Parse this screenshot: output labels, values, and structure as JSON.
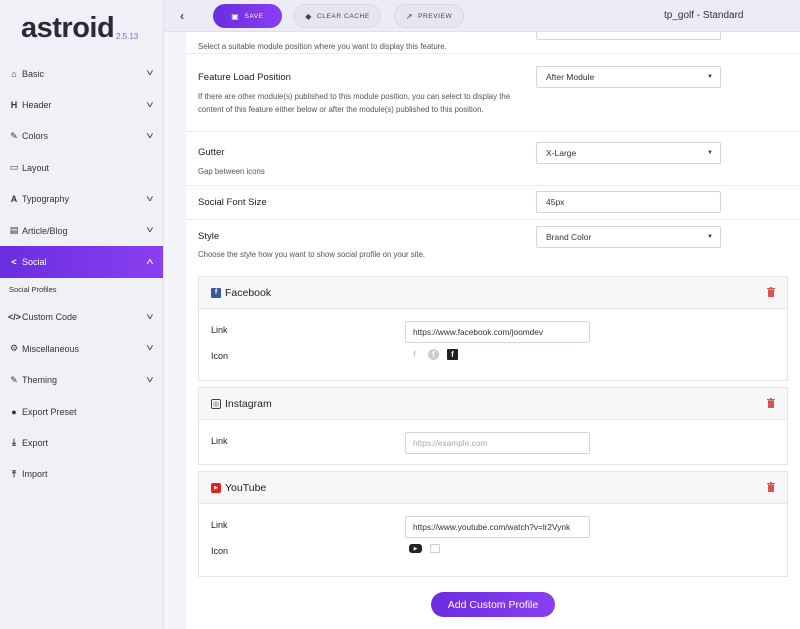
{
  "logo": {
    "text": "astroid",
    "version": "2.5.13"
  },
  "sidebar": {
    "items": [
      {
        "label": "Basic",
        "icon": "home-icon",
        "glyph": "⌂"
      },
      {
        "label": "Header",
        "icon": "header-icon",
        "glyph": "H"
      },
      {
        "label": "Colors",
        "icon": "brush-icon",
        "glyph": "✎"
      },
      {
        "label": "Layout",
        "icon": "layout-icon",
        "glyph": "▭"
      },
      {
        "label": "Typography",
        "icon": "typography-icon",
        "glyph": "A"
      },
      {
        "label": "Article/Blog",
        "icon": "article-icon",
        "glyph": "▤"
      },
      {
        "label": "Social",
        "icon": "share-icon",
        "glyph": "<"
      },
      {
        "label": "Custom Code",
        "icon": "code-icon",
        "glyph": "</>"
      },
      {
        "label": "Miscellaneous",
        "icon": "cogs-icon",
        "glyph": "⚙"
      },
      {
        "label": "Theming",
        "icon": "brush-icon",
        "glyph": "✎"
      },
      {
        "label": "Export Preset",
        "icon": "palette-icon",
        "glyph": "●"
      },
      {
        "label": "Export",
        "icon": "download-icon",
        "glyph": "⤓"
      },
      {
        "label": "Import",
        "icon": "upload-icon",
        "glyph": "⤒"
      }
    ],
    "sub_item": "Social Profiles"
  },
  "toolbar": {
    "save_label": "SAVE",
    "clear_label": "CLEAR CACHE",
    "preview_label": "PREVIEW",
    "template_name": "tp_golf - Standard"
  },
  "settings": {
    "position_desc": "Select a suitable module position where you want to display this feature.",
    "load_position": {
      "title": "Feature Load Position",
      "desc": "If there are other module(s) published to this module position, you can select to display the content of this feature either below or after the module(s) published to this position.",
      "value": "After Module"
    },
    "gutter": {
      "title": "Gutter",
      "desc": "Gap between icons",
      "value": "X-Large"
    },
    "font_size": {
      "title": "Social Font Size",
      "value": "45px"
    },
    "style": {
      "title": "Style",
      "desc": "Choose the style how you want to show social profile on your site.",
      "value": "Brand Color"
    }
  },
  "profiles": {
    "facebook": {
      "name": "Facebook",
      "link_label": "Link",
      "icon_label": "Icon",
      "link": "https://www.facebook.com/joomdev",
      "color": "#3b5998"
    },
    "instagram": {
      "name": "Instagram",
      "link_label": "Link",
      "placeholder": "https://example.com"
    },
    "youtube": {
      "name": "YouTube",
      "link_label": "Link",
      "icon_label": "Icon",
      "link": "https://www.youtube.com/watch?v=lr2Vynk",
      "color": "#e62117"
    }
  },
  "add_label": "Add Custom Profile",
  "colors": {
    "accent": "#7a35e8",
    "trash": "#d9534f"
  }
}
